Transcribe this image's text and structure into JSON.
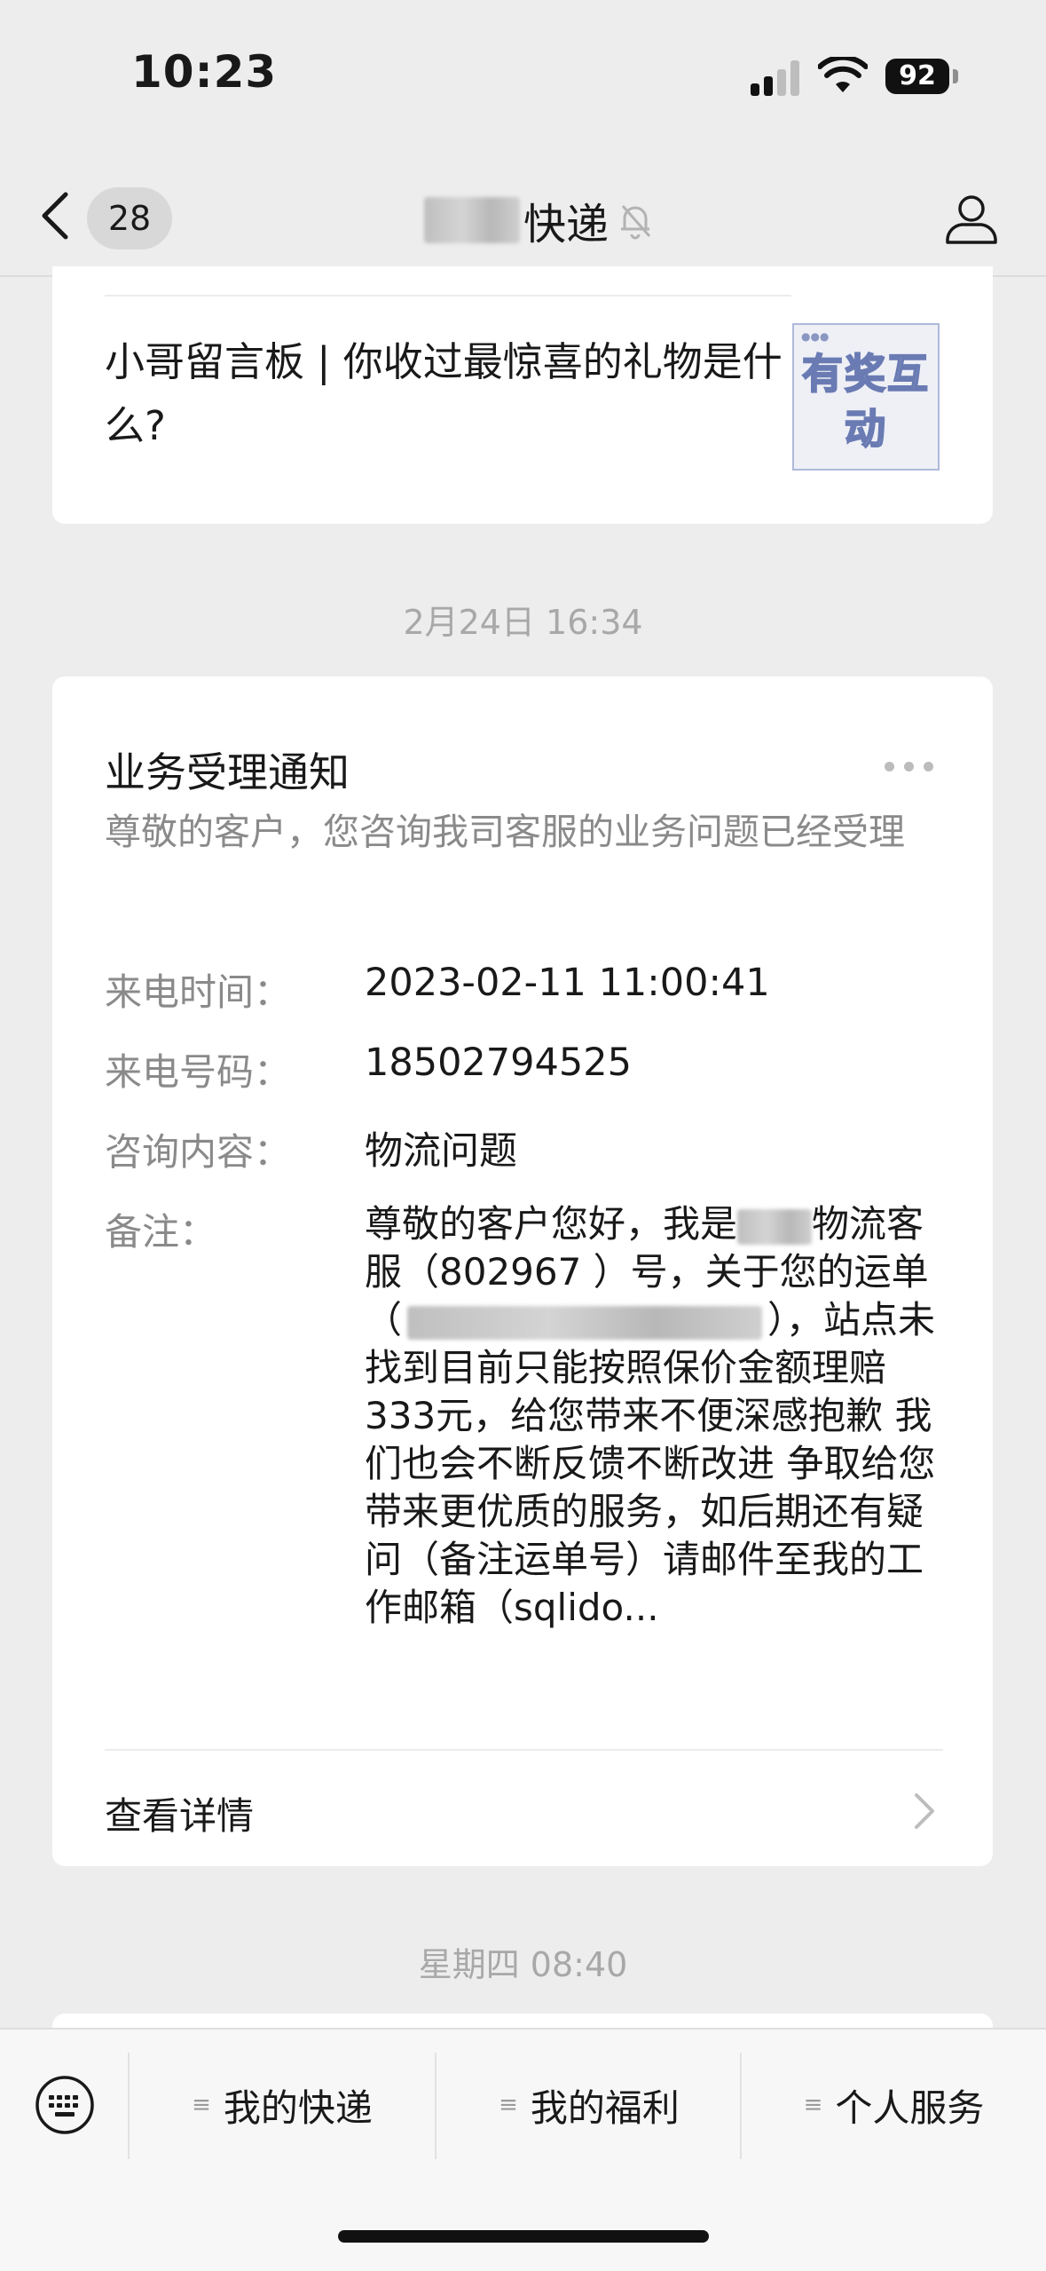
{
  "status_bar": {
    "time": "10:23",
    "battery": "92"
  },
  "nav": {
    "unread_count": "28",
    "title": "快递",
    "title_redacted": true
  },
  "top_card": {
    "article_title": "小哥留言板 | 你收过最惊喜的礼物是什么?",
    "thumbnail_text": "有奖互动"
  },
  "timestamps": {
    "first": "2月24日 16:34",
    "second": "星期四 08:40"
  },
  "notice": {
    "title": "业务受理通知",
    "description": "尊敬的客户，您咨询我司客服的业务问题已经受理",
    "rows": [
      {
        "label": "来电时间：",
        "value": "2023-02-11 11:00:41"
      },
      {
        "label": "来电号码：",
        "value": "18502794525"
      },
      {
        "label": "咨询内容：",
        "value": "物流问题"
      },
      {
        "label": "备注："
      }
    ],
    "remark": {
      "part1": "尊敬的客户您好，我是",
      "part2": "物流客服（802967 ）号，关于您的运单（",
      "part3": "），站点未找到目前只能按照保价金额理赔 333元，给您带来不便深感抱歉 我们也会不断反馈不断改进 争取给您带来更优质的服务，如后期还有疑问（备注运单号）请邮件至我的工作邮箱（sqlido..."
    },
    "detail_link": "查看详情"
  },
  "bottom_menu": {
    "items": [
      {
        "label": "我的快递"
      },
      {
        "label": "我的福利"
      },
      {
        "label": "个人服务"
      }
    ],
    "menu_glyph": "≡"
  }
}
